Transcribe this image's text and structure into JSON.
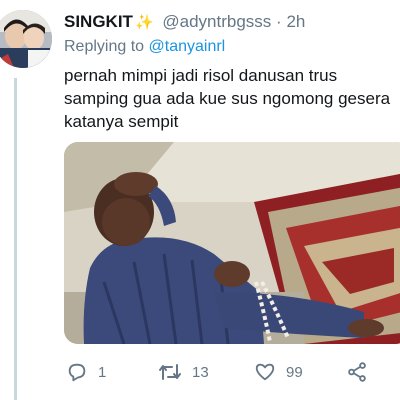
{
  "tweet": {
    "display_name": "SINGKIT",
    "name_emoji": "✨",
    "handle": "@adyntrbgsss",
    "separator": "·",
    "time": "2h",
    "replying_label": "Replying to",
    "replying_handle": "@tanyainrl",
    "text_lines": [
      "pernah mimpi jadi risol danusan trus",
      "samping gua ada kue sus ngomong gesera",
      "katanya sempit"
    ]
  },
  "actions": {
    "reply": {
      "icon": "reply-icon",
      "count": "1"
    },
    "retweet": {
      "icon": "retweet-icon",
      "count": "13"
    },
    "like": {
      "icon": "heart-icon",
      "count": "99"
    },
    "share": {
      "icon": "share-icon"
    }
  },
  "colors": {
    "link": "#1b95e0",
    "secondary_text": "#657786",
    "thread_line": "#ccd6dd",
    "sparkle": "#f5c518"
  }
}
